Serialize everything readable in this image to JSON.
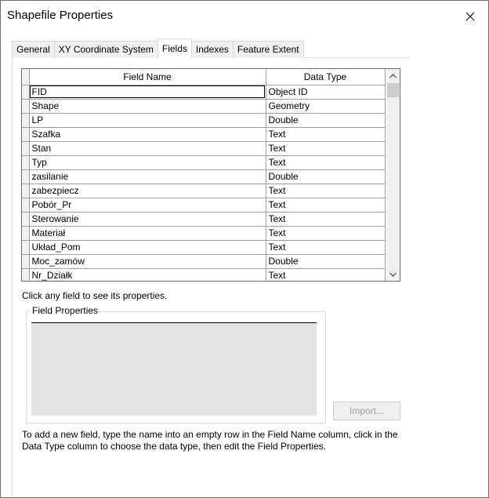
{
  "window": {
    "title": "Shapefile Properties"
  },
  "tabs": [
    {
      "label": "General"
    },
    {
      "label": "XY Coordinate System"
    },
    {
      "label": "Fields",
      "active": true
    },
    {
      "label": "Indexes"
    },
    {
      "label": "Feature Extent"
    }
  ],
  "grid": {
    "columns": [
      "Field Name",
      "Data Type"
    ],
    "rows": [
      {
        "name": "FID",
        "type": "Object ID"
      },
      {
        "name": "Shape",
        "type": "Geometry"
      },
      {
        "name": "LP",
        "type": "Double"
      },
      {
        "name": "Szafka",
        "type": "Text"
      },
      {
        "name": "Stan",
        "type": "Text"
      },
      {
        "name": "Typ",
        "type": "Text"
      },
      {
        "name": "zasilanie",
        "type": "Double"
      },
      {
        "name": "zabezpiecz",
        "type": "Text"
      },
      {
        "name": "Pobór_Pr",
        "type": "Text"
      },
      {
        "name": "Sterowanie",
        "type": "Text"
      },
      {
        "name": "Materiał",
        "type": "Text"
      },
      {
        "name": "Układ_Pom",
        "type": "Text"
      },
      {
        "name": "Moc_zamów",
        "type": "Double"
      },
      {
        "name": "Nr_Działk",
        "type": "Text"
      }
    ]
  },
  "hint": "Click any field to see its properties.",
  "field_properties": {
    "label": "Field Properties"
  },
  "import_button": {
    "label": "Import..."
  },
  "footer": "To add a new field, type the name into an empty row in the Field Name column, click in the Data Type column to choose the data type, then edit the Field Properties.",
  "icons": {
    "close": "close-icon",
    "scroll_up": "chevron-up-icon",
    "scroll_down": "chevron-down-icon"
  }
}
